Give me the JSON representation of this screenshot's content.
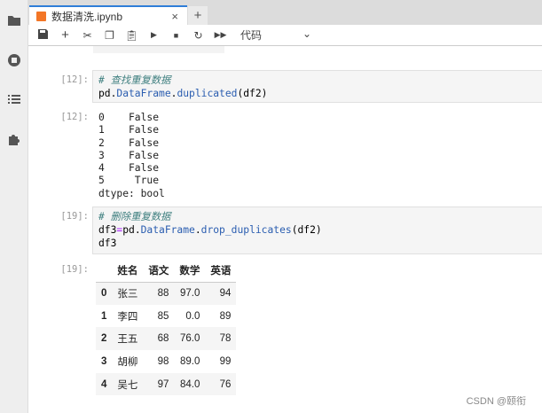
{
  "tab": {
    "title": "数据清洗.ipynb",
    "close": "×",
    "add": "+"
  },
  "toolbar": {
    "cell_type": "代码",
    "chevron": "⌄",
    "icons": [
      "save-icon",
      "add-cell-icon",
      "cut-icon",
      "copy-icon",
      "paste-icon",
      "run-icon",
      "stop-icon",
      "restart-icon",
      "run-all-icon"
    ]
  },
  "cells": [
    {
      "prompt": "[12]:",
      "comment": "# 查找重复数据",
      "code": [
        "pd.",
        "DataFrame",
        ".",
        "duplicated",
        "(df2)"
      ],
      "out_prompt": "[12]:",
      "output": "0    False\n1    False\n2    False\n3    False\n4    False\n5     True\ndtype: bool"
    },
    {
      "prompt": "[19]:",
      "comment": "# 删除重复数据",
      "code2a": "df3",
      "code2op": "=",
      "code2b": "pd.",
      "code2c": "DataFrame",
      "code2d": ".",
      "code2e": "drop_duplicates",
      "code2f": "(df2)",
      "code3": "df3",
      "out_prompt": "[19]:",
      "table": {
        "columns": [
          "姓名",
          "语文",
          "数学",
          "英语"
        ],
        "rows": [
          [
            "0",
            "张三",
            "88",
            "97.0",
            "94"
          ],
          [
            "1",
            "李四",
            "85",
            "0.0",
            "89"
          ],
          [
            "2",
            "王五",
            "68",
            "76.0",
            "78"
          ],
          [
            "3",
            "胡柳",
            "98",
            "89.0",
            "99"
          ],
          [
            "4",
            "吴七",
            "97",
            "84.0",
            "76"
          ]
        ]
      }
    }
  ],
  "watermark": "CSDN @颐衔"
}
